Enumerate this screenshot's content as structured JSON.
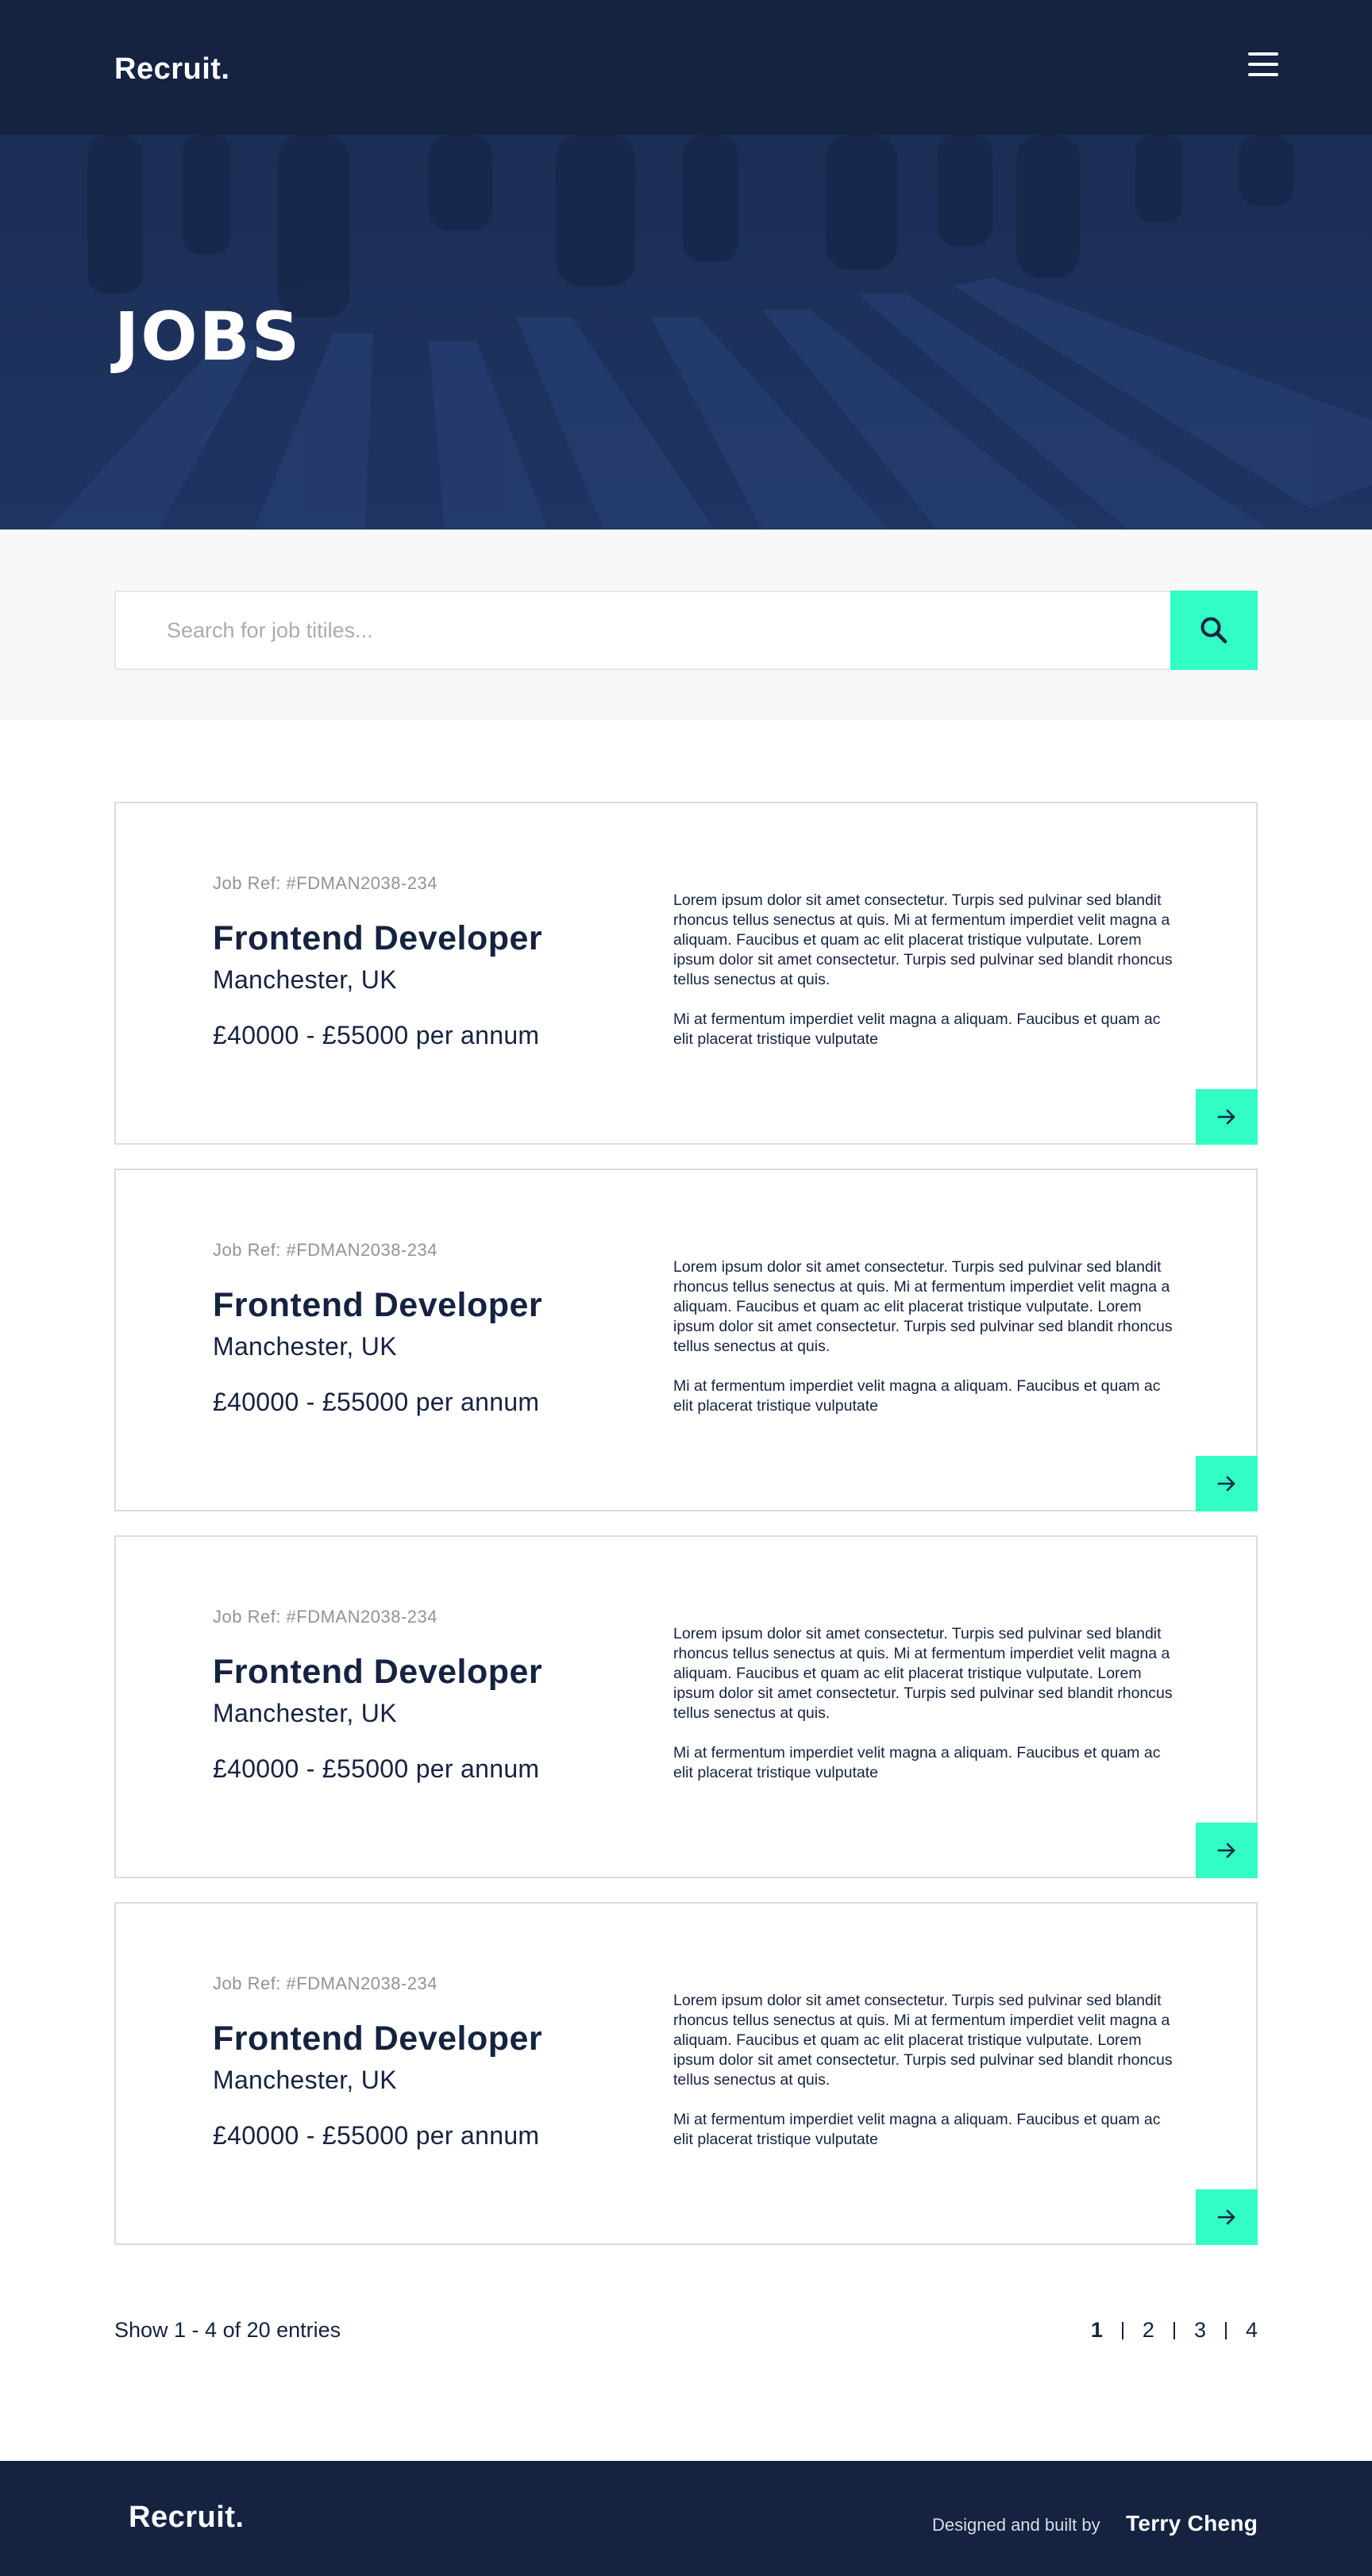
{
  "header": {
    "logo": "Recruit.",
    "menu_icon": "hamburger-menu-icon"
  },
  "hero": {
    "title": "JOBS"
  },
  "search": {
    "placeholder": "Search for job titiles...",
    "value": "",
    "button_icon": "search-icon"
  },
  "jobs": [
    {
      "ref": "Job Ref: #FDMAN2038-234",
      "title": "Frontend Developer",
      "location": "Manchester, UK",
      "salary": "£40000 - £55000 per annum",
      "desc1": "Lorem ipsum dolor sit amet consectetur. Turpis sed pulvinar sed blandit rhoncus tellus senectus at quis. Mi at fermentum imperdiet velit magna a aliquam. Faucibus et quam ac elit placerat tristique vulputate. Lorem ipsum dolor sit amet consectetur. Turpis sed pulvinar sed blandit rhoncus tellus senectus at quis.",
      "desc2": "Mi at fermentum imperdiet velit magna a aliquam. Faucibus et quam ac elit placerat tristique vulputate"
    },
    {
      "ref": "Job Ref: #FDMAN2038-234",
      "title": "Frontend Developer",
      "location": "Manchester, UK",
      "salary": "£40000 - £55000 per annum",
      "desc1": "Lorem ipsum dolor sit amet consectetur. Turpis sed pulvinar sed blandit rhoncus tellus senectus at quis. Mi at fermentum imperdiet velit magna a aliquam. Faucibus et quam ac elit placerat tristique vulputate. Lorem ipsum dolor sit amet consectetur. Turpis sed pulvinar sed blandit rhoncus tellus senectus at quis.",
      "desc2": "Mi at fermentum imperdiet velit magna a aliquam. Faucibus et quam ac elit placerat tristique vulputate"
    },
    {
      "ref": "Job Ref: #FDMAN2038-234",
      "title": "Frontend Developer",
      "location": "Manchester, UK",
      "salary": "£40000 - £55000 per annum",
      "desc1": "Lorem ipsum dolor sit amet consectetur. Turpis sed pulvinar sed blandit rhoncus tellus senectus at quis. Mi at fermentum imperdiet velit magna a aliquam. Faucibus et quam ac elit placerat tristique vulputate. Lorem ipsum dolor sit amet consectetur. Turpis sed pulvinar sed blandit rhoncus tellus senectus at quis.",
      "desc2": "Mi at fermentum imperdiet velit magna a aliquam. Faucibus et quam ac elit placerat tristique vulputate"
    },
    {
      "ref": "Job Ref: #FDMAN2038-234",
      "title": "Frontend Developer",
      "location": "Manchester, UK",
      "salary": "£40000 - £55000 per annum",
      "desc1": "Lorem ipsum dolor sit amet consectetur. Turpis sed pulvinar sed blandit rhoncus tellus senectus at quis. Mi at fermentum imperdiet velit magna a aliquam. Faucibus et quam ac elit placerat tristique vulputate. Lorem ipsum dolor sit amet consectetur. Turpis sed pulvinar sed blandit rhoncus tellus senectus at quis.",
      "desc2": "Mi at fermentum imperdiet velit magna a aliquam. Faucibus et quam ac elit placerat tristique vulputate"
    }
  ],
  "pagination": {
    "summary": "Show 1 - 4 of 20 entries",
    "pages": [
      "1",
      "2",
      "3",
      "4"
    ],
    "current": "1"
  },
  "footer": {
    "logo": "Recruit.",
    "credit": "Designed and built by",
    "author": "Terry Cheng"
  },
  "colors": {
    "navy": "#152341",
    "accent": "#31fdc4",
    "band": "#f8f8f8"
  }
}
